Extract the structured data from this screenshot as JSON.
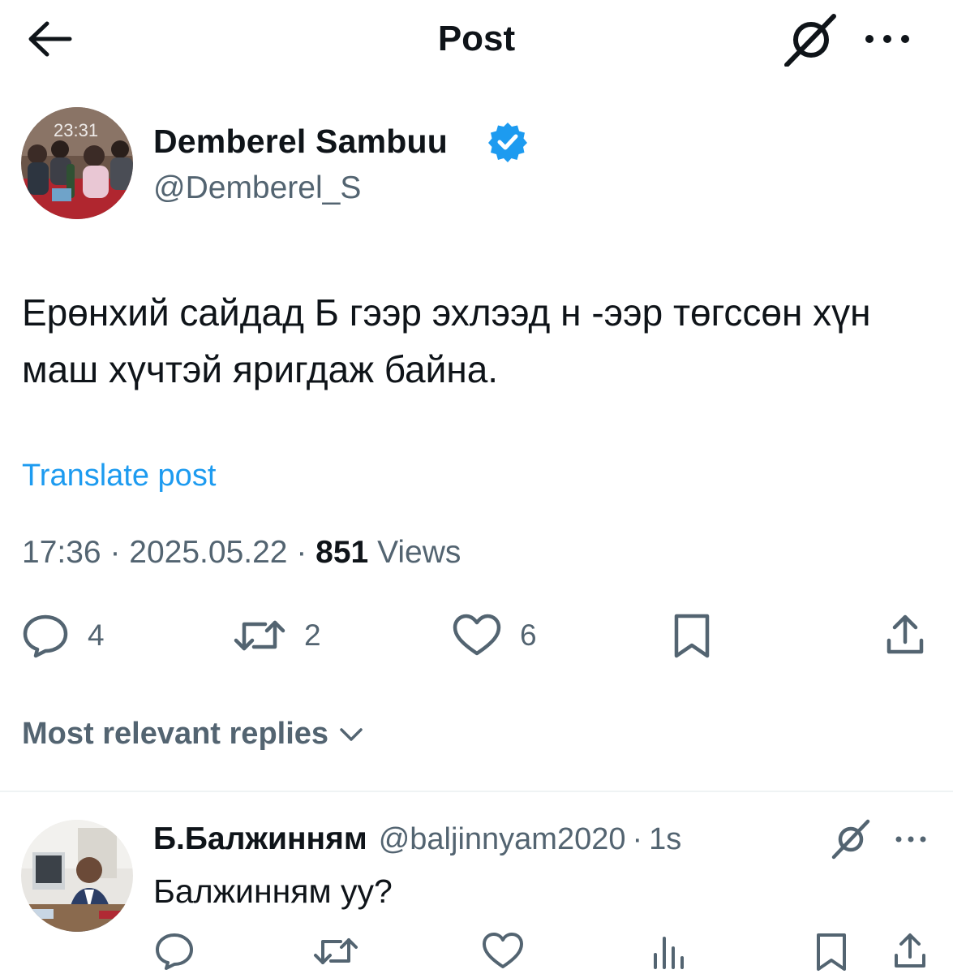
{
  "header": {
    "title": "Post"
  },
  "post": {
    "author": {
      "name": "Demberel Sambuu",
      "handle": "@Demberel_S",
      "verified": true
    },
    "avatar_overlay_text": "23:31",
    "text": "Ерөнхий сайдад Б гээр эхлээд н -ээр төгссөн хүн маш хүчтэй яригдаж байна.",
    "translate_label": "Translate post",
    "time": "17:36",
    "date": "2025.05.22",
    "views_count": "851",
    "views_label": "Views",
    "stats": {
      "replies": "4",
      "reposts": "2",
      "likes": "6"
    }
  },
  "replies_section": {
    "filter_label": "Most relevant replies"
  },
  "reply": {
    "name": "Б.Балжинням",
    "handle": "@baljinnyam2020",
    "separator": "·",
    "time": "1s",
    "text": "Балжинням уу?"
  },
  "colors": {
    "text_primary": "#0f1419",
    "text_secondary": "#536471",
    "link": "#1d9bf0",
    "divider": "#eff3f4",
    "verified": "#1d9bf0"
  }
}
